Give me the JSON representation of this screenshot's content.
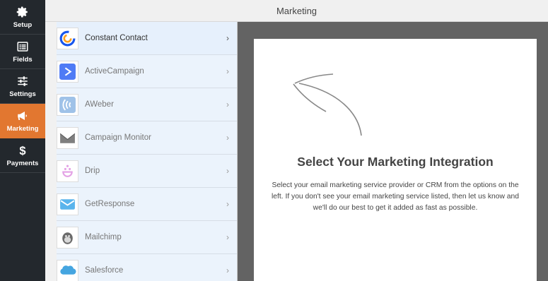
{
  "rail": {
    "items": [
      {
        "label": "Setup",
        "icon": "gear-icon"
      },
      {
        "label": "Fields",
        "icon": "fields-icon"
      },
      {
        "label": "Settings",
        "icon": "sliders-icon"
      },
      {
        "label": "Marketing",
        "icon": "megaphone-icon",
        "active": true
      },
      {
        "label": "Payments",
        "icon": "dollar-icon"
      }
    ]
  },
  "header": {
    "title": "Marketing"
  },
  "providers": [
    {
      "name": "Constant Contact",
      "icon": "constant-contact-icon"
    },
    {
      "name": "ActiveCampaign",
      "icon": "activecampaign-icon"
    },
    {
      "name": "AWeber",
      "icon": "aweber-icon"
    },
    {
      "name": "Campaign Monitor",
      "icon": "campaign-monitor-icon"
    },
    {
      "name": "Drip",
      "icon": "drip-icon"
    },
    {
      "name": "GetResponse",
      "icon": "getresponse-icon"
    },
    {
      "name": "Mailchimp",
      "icon": "mailchimp-icon"
    },
    {
      "name": "Salesforce",
      "icon": "salesforce-icon"
    }
  ],
  "panel": {
    "title": "Select Your Marketing Integration",
    "description": "Select your email marketing service provider or CRM from the options on the left. If you don't see your email marketing service listed, then let us know and we'll do our best to get it added as fast as possible."
  },
  "colors": {
    "accent": "#e27730",
    "rail": "#23282d",
    "canvas": "#636363"
  }
}
